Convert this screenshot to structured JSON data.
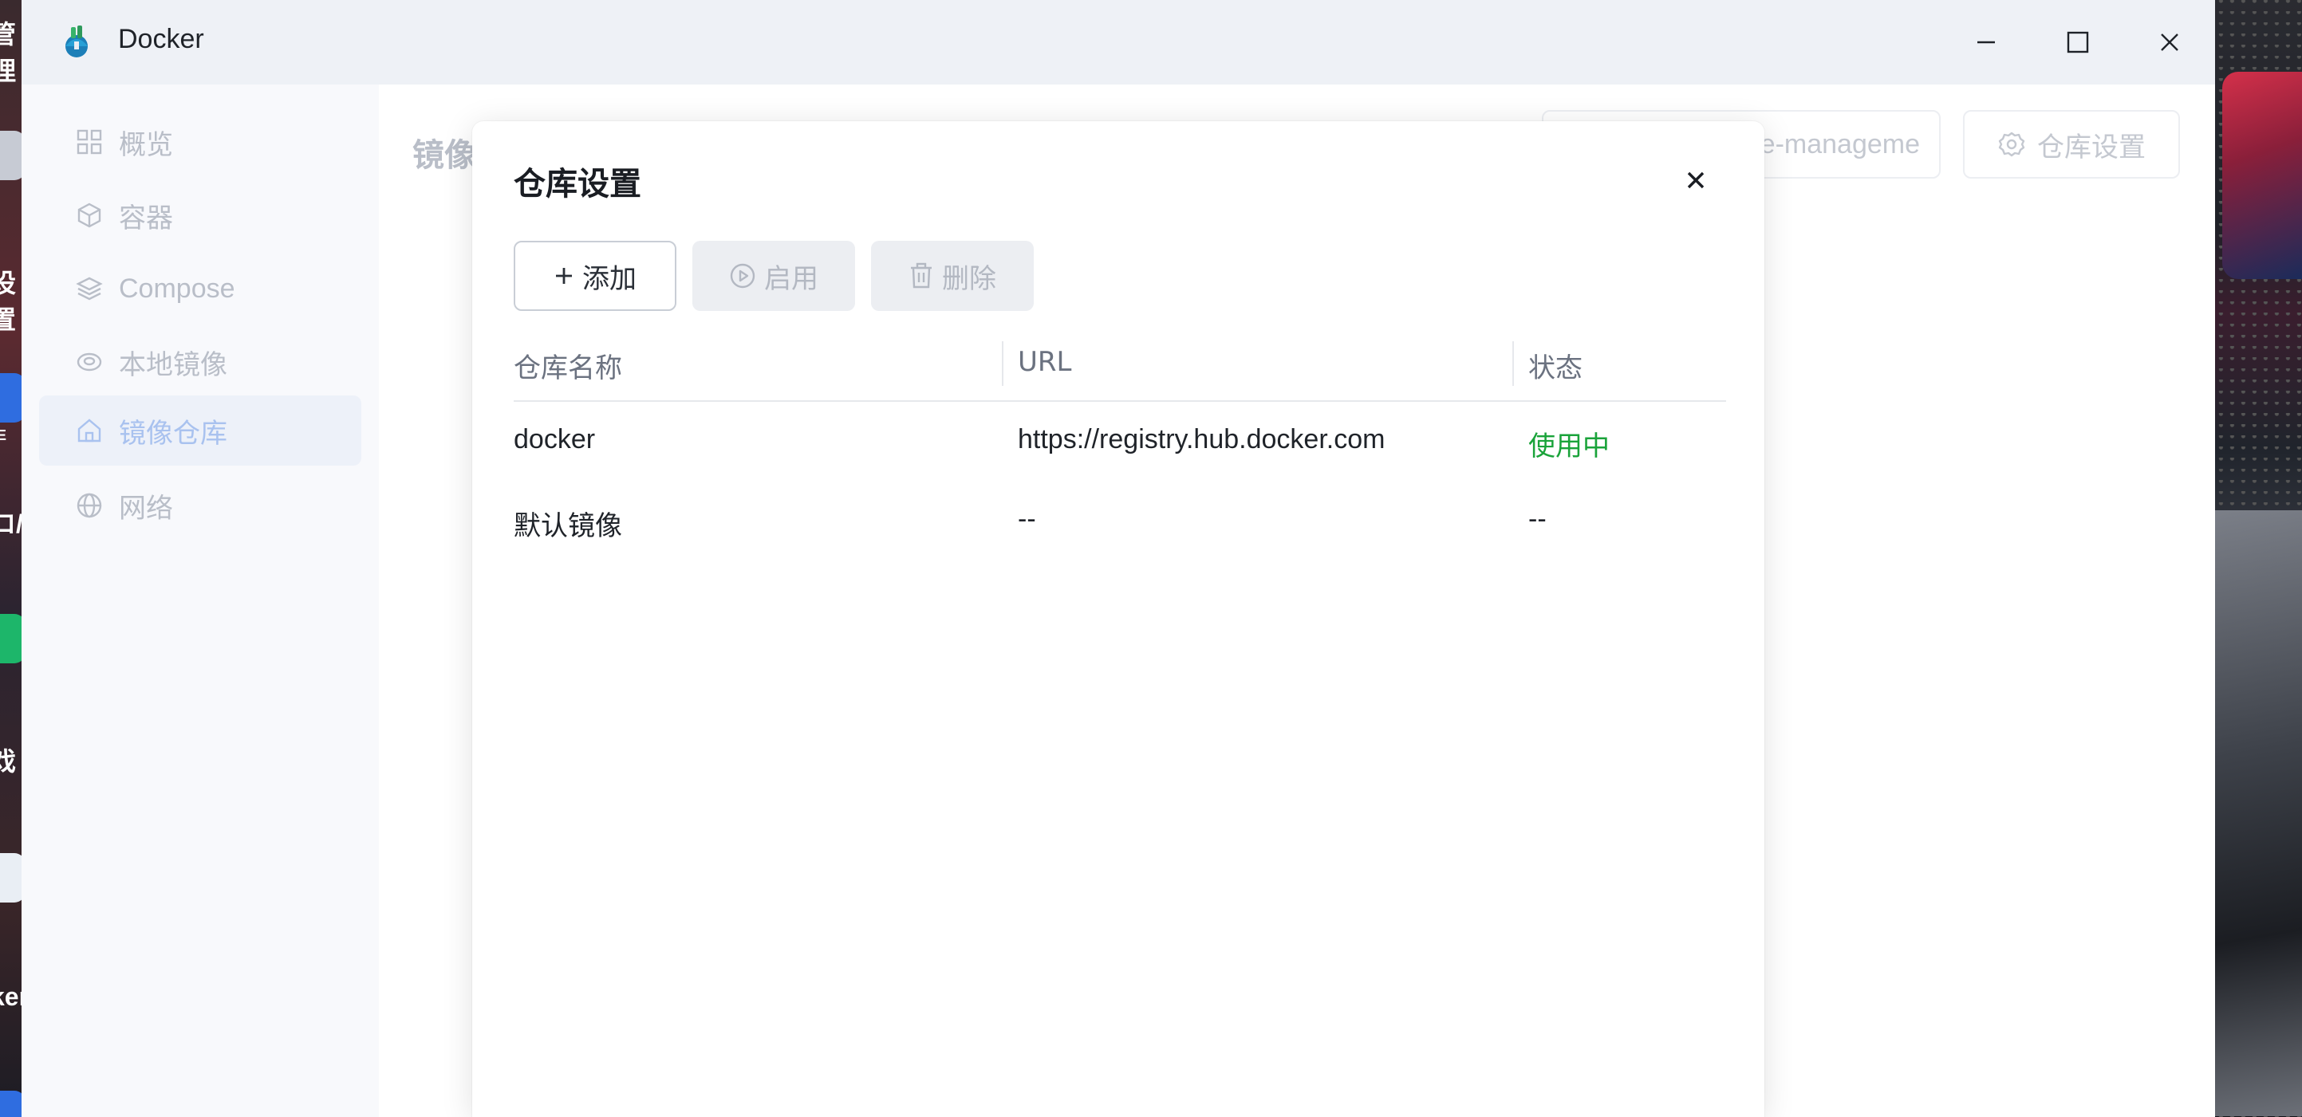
{
  "window": {
    "title": "Docker"
  },
  "desktop": {
    "left_labels": [
      "管理",
      "设置",
      "E",
      "ロ/",
      "戏",
      "ker"
    ]
  },
  "sidebar": {
    "items": [
      {
        "label": "概览",
        "icon": "grid-icon",
        "active": false
      },
      {
        "label": "容器",
        "icon": "cube-icon",
        "active": false
      },
      {
        "label": "Compose",
        "icon": "layers-icon",
        "active": false
      },
      {
        "label": "本地镜像",
        "icon": "disc-icon",
        "active": false
      },
      {
        "label": "镜像仓库",
        "icon": "home-icon",
        "active": true
      },
      {
        "label": "网络",
        "icon": "globe-icon",
        "active": false
      }
    ]
  },
  "main": {
    "title": "镜像",
    "search_value": "e-manageme",
    "repo_settings_label": "仓库设置"
  },
  "modal": {
    "title": "仓库设置",
    "buttons": {
      "add": "添加",
      "enable": "启用",
      "delete": "删除"
    },
    "table": {
      "columns": [
        "仓库名称",
        "URL",
        "状态"
      ],
      "rows": [
        {
          "name": "docker",
          "url": "https://registry.hub.docker.com",
          "status": "使用中"
        },
        {
          "name": "默认镜像",
          "url": "--",
          "status": "--"
        }
      ]
    }
  },
  "colors": {
    "accent_active_text": "#a9c2ef",
    "status_active": "#1aa33a"
  }
}
